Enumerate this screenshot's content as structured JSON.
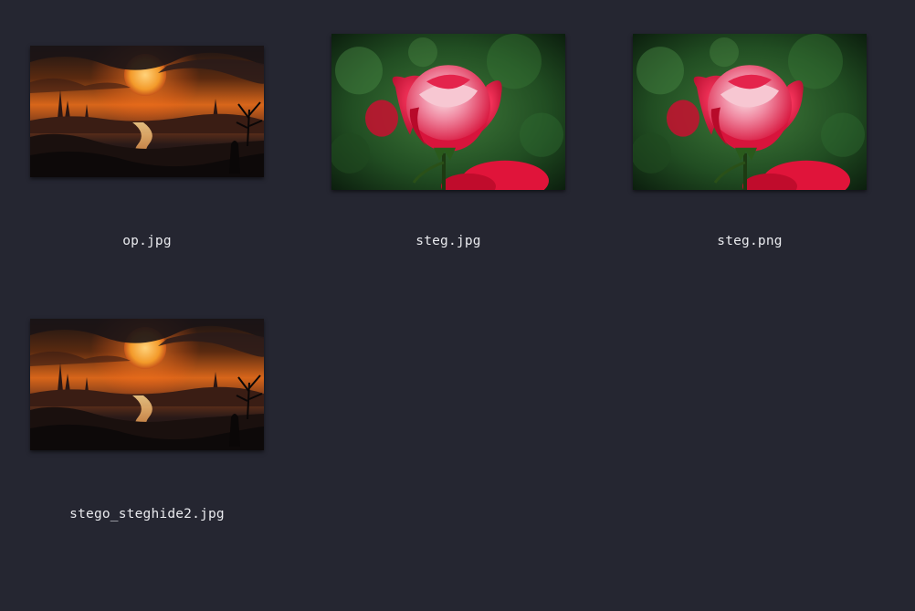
{
  "files": [
    {
      "name": "op.jpg",
      "thumbnail": "sunset-landscape-thumbnail"
    },
    {
      "name": "steg.jpg",
      "thumbnail": "red-rose-thumbnail"
    },
    {
      "name": "steg.png",
      "thumbnail": "red-rose-thumbnail"
    },
    {
      "name": "stego_steghide2.jpg",
      "thumbnail": "sunset-landscape-thumbnail"
    }
  ],
  "colors": {
    "background": "#252631",
    "text": "#e9eaee"
  }
}
